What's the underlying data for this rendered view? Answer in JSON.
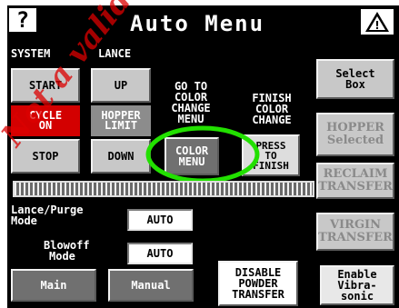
{
  "header": {
    "help_icon_text": "?",
    "title": "Auto Menu",
    "warning_icon_text": "!"
  },
  "labels": {
    "system": "SYSTEM",
    "lance": "LANCE",
    "go_to_color_change_menu": [
      "GO TO",
      "COLOR",
      "CHANGE",
      "MENU"
    ],
    "finish_color_change": [
      "FINISH",
      "COLOR",
      "CHANGE"
    ],
    "lance_purge_mode": [
      "Lance/Purge",
      "Mode"
    ],
    "blowoff_mode": [
      "Blowoff",
      "Mode"
    ]
  },
  "buttons": {
    "start": "START",
    "up": "UP",
    "stop": "STOP",
    "down": "DOWN",
    "color_menu": [
      "COLOR",
      "MENU"
    ],
    "press_to_finish": [
      "PRESS",
      "TO",
      "FINISH"
    ],
    "select_box": [
      "Select",
      "Box"
    ],
    "hopper_selected": [
      "HOPPER",
      "Selected"
    ],
    "reclaim_transfer": [
      "RECLAIM",
      "TRANSFER"
    ],
    "virgin_transfer": [
      "VIRGIN",
      "TRANSFER"
    ],
    "main": "Main",
    "manual": "Manual",
    "disable_powder_transfer": [
      "DISABLE",
      "POWDER",
      "TRANSFER"
    ],
    "enable_vibrasonic": [
      "Enable",
      "Vibra-",
      "sonic"
    ]
  },
  "status": {
    "cycle_on": [
      "CYCLE",
      "ON"
    ],
    "hopper_limit": [
      "HOPPER",
      "LIMIT"
    ]
  },
  "values": {
    "lance_purge_mode": "AUTO",
    "blowoff_mode": "AUTO"
  },
  "watermark_text": "Not a valid",
  "colors": {
    "background": "#000000",
    "button": "#c8c8c8",
    "status_active": "#d30000",
    "status_inactive": "#8c8c8c",
    "highlight_circle": "#22e000"
  }
}
